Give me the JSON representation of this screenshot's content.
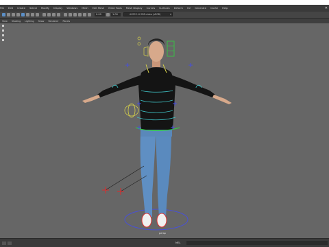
{
  "menu": {
    "items": [
      "File",
      "Edit",
      "Create",
      "Select",
      "Modify",
      "Display",
      "Windows",
      "Mesh",
      "Edit Mesh",
      "Mesh Tools",
      "Mesh Display",
      "Curves",
      "Surfaces",
      "Deform",
      "UV",
      "Generate",
      "Cache",
      "Help"
    ]
  },
  "toolbar": {
    "frame_value": "0.00",
    "scale_value": "1.00",
    "camera_select": "ACES 1.0 SDR-video (sRGB)"
  },
  "panel_menu": {
    "items": [
      "View",
      "Shading",
      "Lighting",
      "Show",
      "Renderer",
      "Panels"
    ]
  },
  "viewport": {
    "camera_label": "persp"
  },
  "command_line": {
    "language": "MEL",
    "value": ""
  },
  "colors": {
    "viewport_bg": "#666666",
    "sweater": "#111111",
    "jeans": "#5f8fc3",
    "ik_curve": "#3fc3c6",
    "control_green": "#2fd43f",
    "control_blue": "#4850d8",
    "control_red": "#e02a2a",
    "control_yellow": "#d7d14a"
  },
  "icons": [
    "window-close-icon",
    "select-tool-icon",
    "move-tool-icon",
    "rotate-tool-icon",
    "scale-tool-icon",
    "snap-icon",
    "camera-icon",
    "grid-icon",
    "shaded-icon"
  ]
}
